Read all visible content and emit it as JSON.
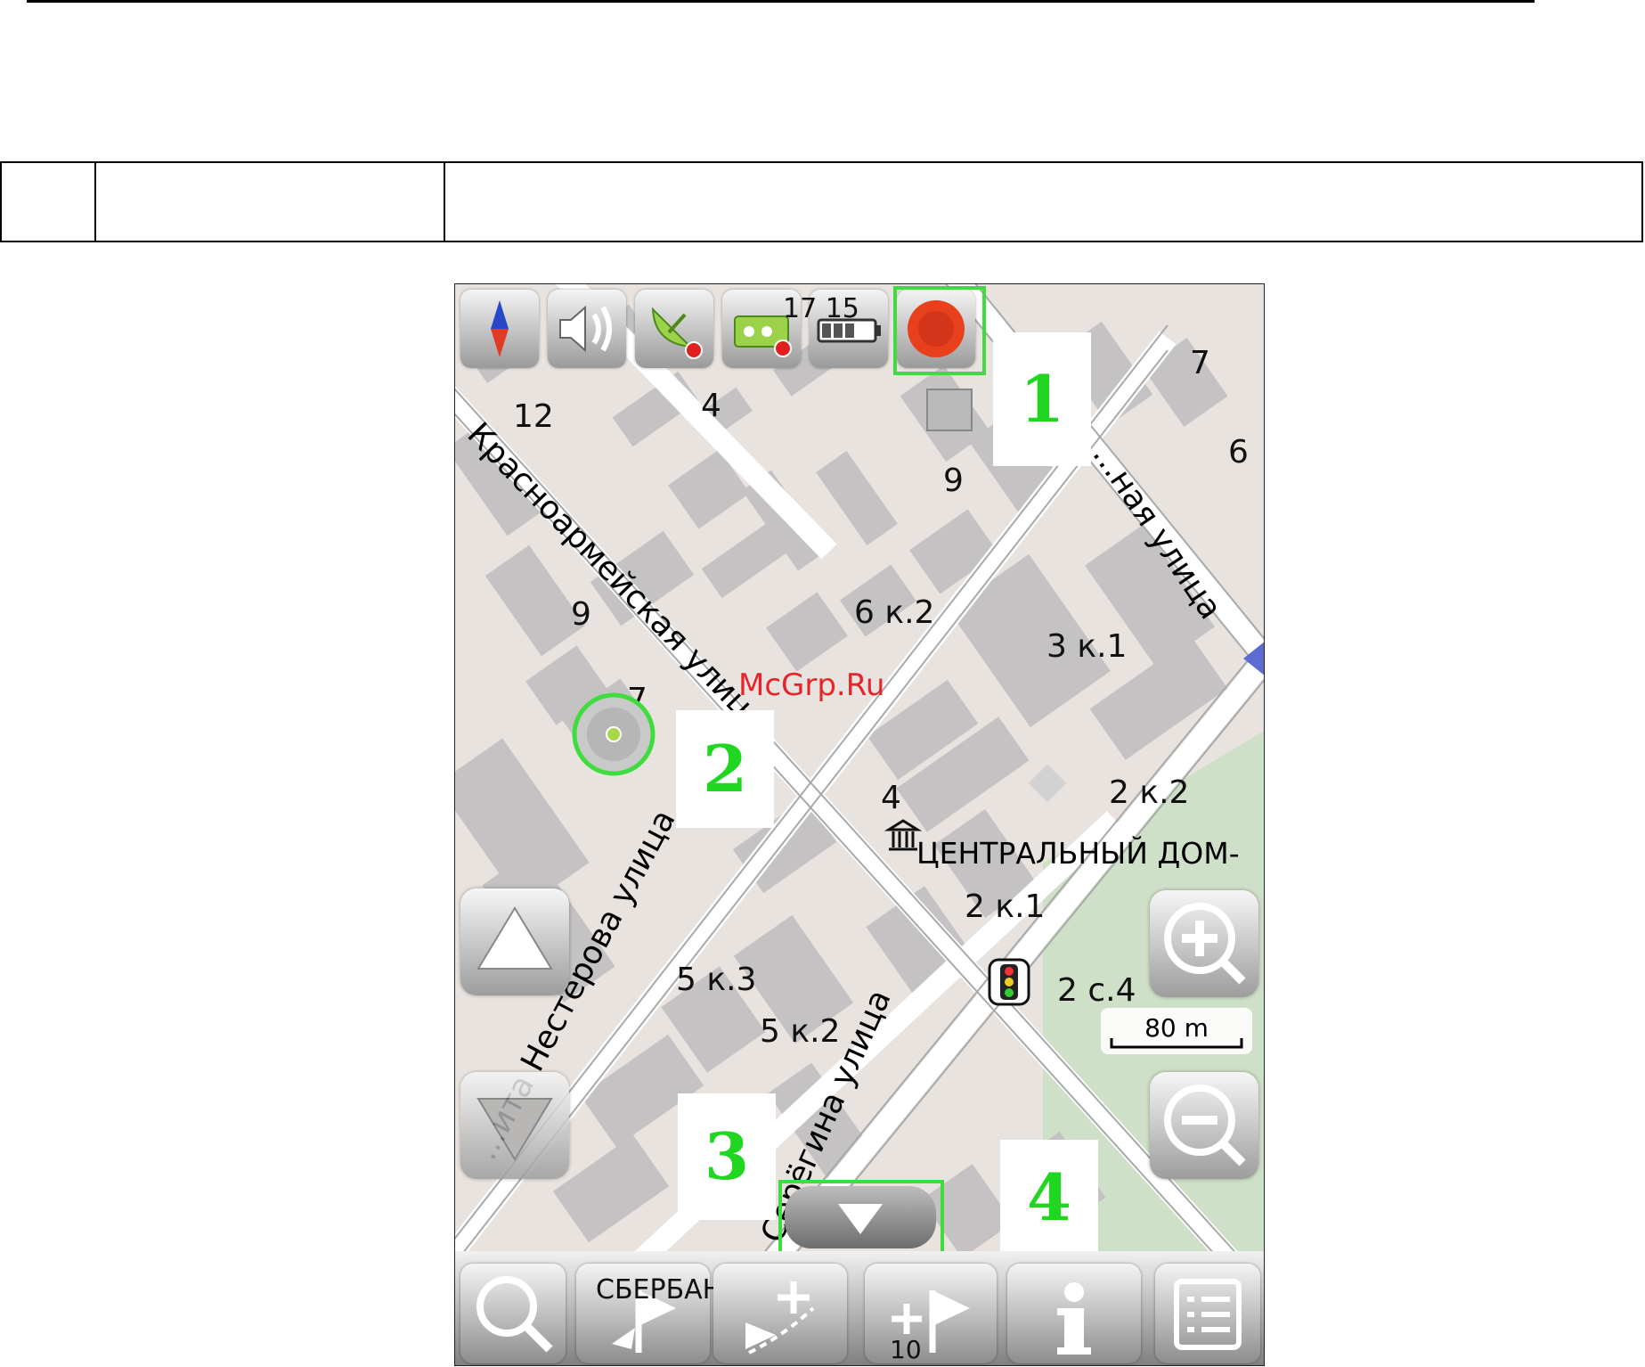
{
  "map": {
    "streets": [
      {
        "name": "Красноармейская улица"
      },
      {
        "name": "...ная улица"
      },
      {
        "name": "...ита Нестерова улица"
      },
      {
        "name": "Серёгина улица"
      }
    ],
    "house_numbers": [
      "12",
      "4",
      "7",
      "6",
      "9",
      "9",
      "6 к.2",
      "3 к.1",
      "7",
      "4",
      "2 к.2",
      "2 к.1",
      "5 к.3",
      "5 к.2",
      "2 с.4"
    ],
    "poi_label": "ЦЕНТРАЛЬНЫЙ ДОМ-",
    "bank_label": "СБЕРБАНК",
    "scale_label": "80 m",
    "watermark": "McGrp.Ru",
    "tb_overlay": "17 15",
    "bottom_overlay": "10"
  },
  "toolbar": {
    "icons": [
      "compass-icon",
      "speaker-icon",
      "satellite-icon",
      "gps-device-icon",
      "battery-icon",
      "record-button-icon"
    ]
  },
  "callouts": [
    "1",
    "2",
    "3",
    "4"
  ],
  "colors": {
    "highlight": "#3fdc3f",
    "callout_text": "#21d621",
    "record": "#e8401c"
  }
}
